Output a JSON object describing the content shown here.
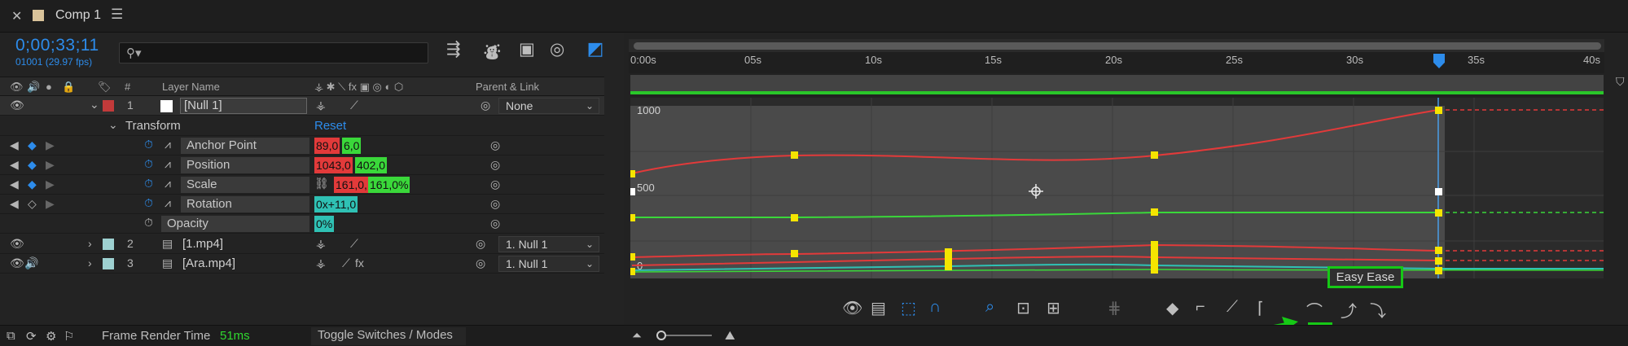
{
  "tab": {
    "title": "Comp 1"
  },
  "timecode": {
    "time": "0;00;33;11",
    "frames": "01001 (29.97 fps)"
  },
  "header": {
    "layer_name": "Layer Name",
    "parent_link": "Parent & Link",
    "num": "#"
  },
  "layers": [
    {
      "num": "1",
      "name": "[Null 1]",
      "parent": "None",
      "color": "#c23a3a"
    },
    {
      "num": "2",
      "name": "[1.mp4]",
      "parent": "1. Null 1",
      "color": "#9ed1d1"
    },
    {
      "num": "3",
      "name": "[Ara.mp4]",
      "parent": "1. Null 1",
      "color": "#9ed1d1"
    }
  ],
  "transform": {
    "label": "Transform",
    "reset": "Reset"
  },
  "props": [
    {
      "name": "Anchor Point",
      "v1": "89,0",
      "v2": "6,0"
    },
    {
      "name": "Position",
      "v1": "1043,0",
      "v2": "402,0"
    },
    {
      "name": "Scale",
      "v1": "161,0,",
      "v2": "161,0%"
    },
    {
      "name": "Rotation",
      "v1": "0x+11,0"
    },
    {
      "name": "Opacity",
      "v1": "0%"
    }
  ],
  "ruler": {
    "labels": [
      "0:00s",
      "05s",
      "10s",
      "15s",
      "20s",
      "25s",
      "30s",
      "35s",
      "40s"
    ]
  },
  "graph": {
    "y_labels": [
      "1000",
      "500",
      "0"
    ]
  },
  "bottom": {
    "render_label": "Frame Render Time",
    "render_value": "51ms",
    "toggle": "Toggle Switches / Modes"
  },
  "easy_ease": {
    "label": "Easy Ease"
  },
  "colors": {
    "accent": "#2d8ceb",
    "highlight": "#16c916"
  }
}
